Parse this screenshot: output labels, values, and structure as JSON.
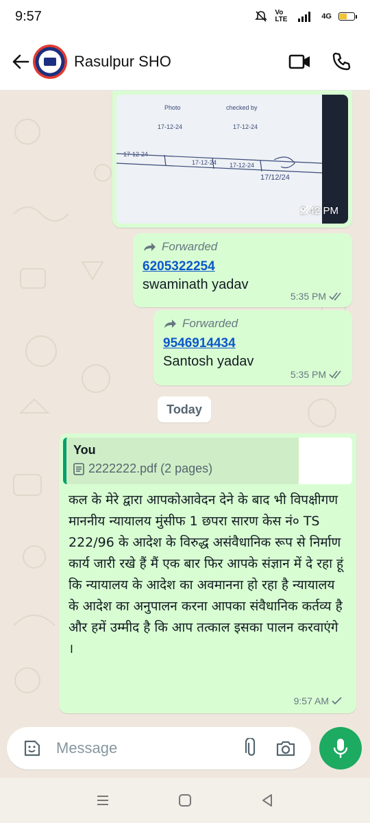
{
  "status_bar": {
    "time": "9:57",
    "network_label": "Vo LTE",
    "signal_label": "4G"
  },
  "header": {
    "title": "Rasulpur SHO",
    "avatar_icon": "police-emblem-icon",
    "back_icon": "arrow-left-icon",
    "video_icon": "video-call-icon",
    "call_icon": "phone-icon"
  },
  "messages": {
    "image_message": {
      "time": "2:42 PM",
      "handwriting": [
        "Photo",
        "checked by",
        "17-12-24",
        "17-12-24",
        "17-12-24",
        "17-12-24",
        "17-12-24",
        "17/12/24"
      ]
    },
    "forwarded_1": {
      "label": "Forwarded",
      "phone": "6205322254",
      "name": "swaminath yadav",
      "time": "5:35 PM"
    },
    "forwarded_2": {
      "label": "Forwarded",
      "phone": "9546914434",
      "name": "Santosh yadav",
      "time": "5:35 PM"
    },
    "date_chip": "Today",
    "reply_message": {
      "quote_author": "You",
      "quote_file": "2222222.pdf (2 pages)",
      "text": "कल के मेरे द्वारा आपकोआवेदन देने के बाद भी विपक्षीगण माननीय  न्यायालय मुंसीफ 1 छपरा सारण केस नं० TS 222/96 के आदेश के विरुद्ध असंवैधानिक रूप से निर्माण कार्य जारी रखे हैं मैं एक बार फिर आपके संज्ञान में दे रहा हूं कि न्यायालय के आदेश का  अवमानना हो रहा है न्यायालय के आदेश का अनुपालन करना आपका संवैधानिक कर्तव्य है और हमें उम्मीद है कि आप तत्काल इसका  पालन करवाएंगे ।",
      "time": "9:57 AM"
    }
  },
  "input": {
    "placeholder": "Message",
    "value": ""
  },
  "colors": {
    "outgoing_bubble": "#d9fdd3",
    "chat_background": "#efe7dd",
    "accent_green": "#1daa61",
    "link_blue": "#0b58c9",
    "read_tick": "#667781"
  }
}
